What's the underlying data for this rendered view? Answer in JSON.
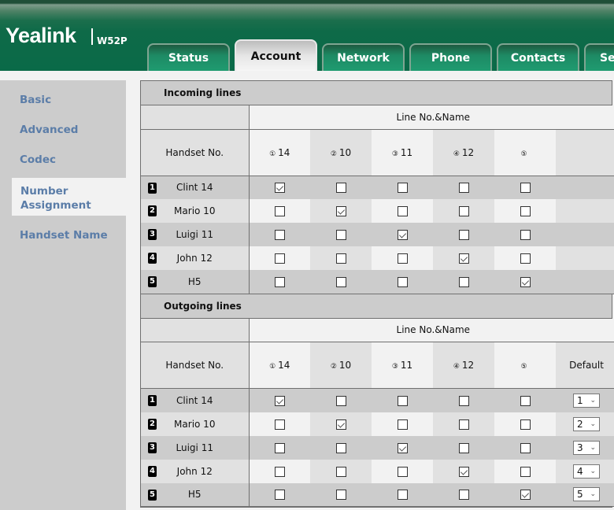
{
  "header": {
    "brand": "Yealink",
    "model": "W52P",
    "tabs": [
      {
        "label": "Status",
        "active": false
      },
      {
        "label": "Account",
        "active": true
      },
      {
        "label": "Network",
        "active": false
      },
      {
        "label": "Phone",
        "active": false
      },
      {
        "label": "Contacts",
        "active": false
      },
      {
        "label": "Se",
        "active": false
      }
    ]
  },
  "sidebar": {
    "items": [
      {
        "label": "Basic"
      },
      {
        "label": "Advanced"
      },
      {
        "label": "Codec"
      },
      {
        "label": "Number Assignment",
        "line1": "Number",
        "line2": "Assignment",
        "active": true
      },
      {
        "label": "Handset Name"
      }
    ]
  },
  "incoming": {
    "title": "Incoming lines",
    "line_header": "Line No.&Name",
    "handset_header": "Handset No.",
    "lines": [
      {
        "icon": "①",
        "name": "14"
      },
      {
        "icon": "②",
        "name": "10"
      },
      {
        "icon": "③",
        "name": "11"
      },
      {
        "icon": "④",
        "name": "12"
      },
      {
        "icon": "⑤",
        "name": ""
      }
    ],
    "extra_header": "",
    "rows": [
      {
        "num": "1",
        "name": "Clint 14",
        "checks": [
          true,
          false,
          false,
          false,
          false
        ]
      },
      {
        "num": "2",
        "name": "Mario 10",
        "checks": [
          false,
          true,
          false,
          false,
          false
        ]
      },
      {
        "num": "3",
        "name": "Luigi 11",
        "checks": [
          false,
          false,
          true,
          false,
          false
        ]
      },
      {
        "num": "4",
        "name": "John 12",
        "checks": [
          false,
          false,
          false,
          true,
          false
        ]
      },
      {
        "num": "5",
        "name": "H5",
        "checks": [
          false,
          false,
          false,
          false,
          true
        ]
      }
    ]
  },
  "outgoing": {
    "title": "Outgoing lines",
    "line_header": "Line No.&Name",
    "handset_header": "Handset No.",
    "lines": [
      {
        "icon": "①",
        "name": "14"
      },
      {
        "icon": "②",
        "name": "10"
      },
      {
        "icon": "③",
        "name": "11"
      },
      {
        "icon": "④",
        "name": "12"
      },
      {
        "icon": "⑤",
        "name": ""
      }
    ],
    "extra_header": "Default",
    "rows": [
      {
        "num": "1",
        "name": "Clint 14",
        "checks": [
          true,
          false,
          false,
          false,
          false
        ],
        "default": "1"
      },
      {
        "num": "2",
        "name": "Mario 10",
        "checks": [
          false,
          true,
          false,
          false,
          false
        ],
        "default": "2"
      },
      {
        "num": "3",
        "name": "Luigi 11",
        "checks": [
          false,
          false,
          true,
          false,
          false
        ],
        "default": "3"
      },
      {
        "num": "4",
        "name": "John 12",
        "checks": [
          false,
          false,
          false,
          true,
          false
        ],
        "default": "4"
      },
      {
        "num": "5",
        "name": "H5",
        "checks": [
          false,
          false,
          false,
          false,
          true
        ],
        "default": "5"
      }
    ]
  }
}
